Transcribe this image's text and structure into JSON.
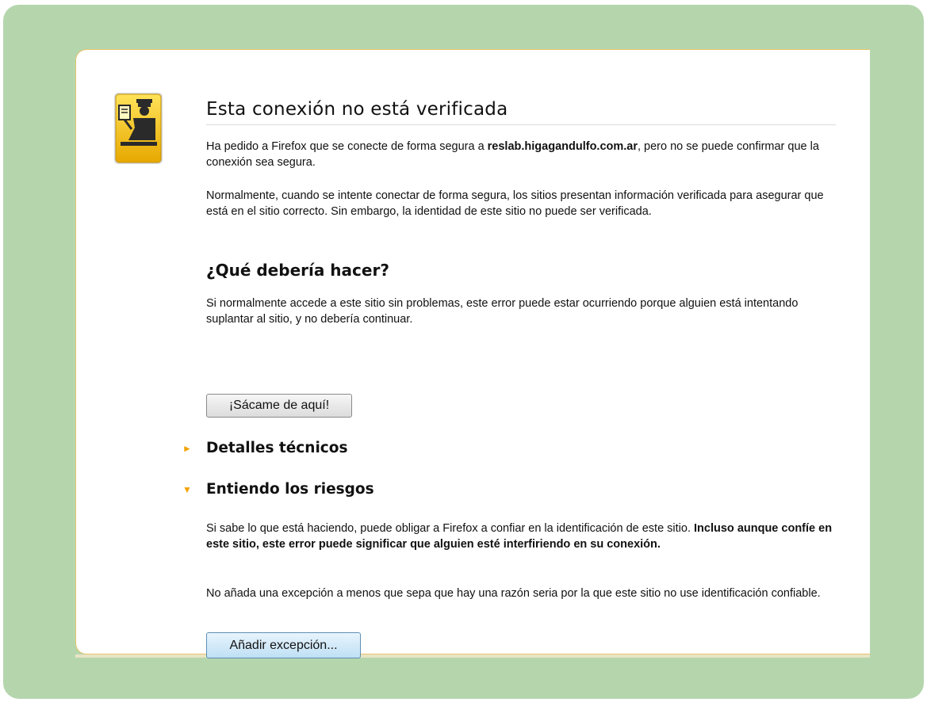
{
  "page": {
    "title": "Esta conexión no está verificada",
    "intro_prefix": "Ha pedido a Firefox que se conecte de forma segura a ",
    "intro_host": "reslab.higagandulfo.com.ar",
    "intro_suffix": ", pero no se puede confirmar que la conexión sea segura.",
    "explanation": "Normalmente, cuando se intente conectar de forma segura, los sitios presentan información verificada para asegurar que está en el sitio correcto. Sin embargo, la identidad de este sitio no puede ser verificada."
  },
  "what_to_do": {
    "heading": "¿Qué debería hacer?",
    "text": "Si normalmente accede a este sitio sin problemas, este error puede estar ocurriendo porque alguien está intentando suplantar al sitio, y no debería continuar.",
    "get_me_out_label": "¡Sácame de aquí!"
  },
  "technical_details": {
    "label": "Detalles técnicos",
    "expanded": false,
    "triangle": "►"
  },
  "risks": {
    "label": "Entiendo los riesgos",
    "expanded": true,
    "triangle": "▼",
    "text_normal": "Si sabe lo que está haciendo, puede obligar a Firefox a confiar en la identificación de este sitio. ",
    "text_bold": "Incluso aunque confíe en este sitio, este error puede significar que alguien esté interfiriendo en su conexión.",
    "warning": "No añada una excepción a menos que sepa que hay una razón seria por la que este sitio no use identificación confiable.",
    "add_exception_label": "Añadir excepción..."
  },
  "icons": {
    "header_icon": "security-officer-icon"
  },
  "colors": {
    "frame_background": "#b5d6ad",
    "panel_border": "#e8c46a",
    "triangle": "#f2a300",
    "icon_yellow": "#f5c400"
  }
}
